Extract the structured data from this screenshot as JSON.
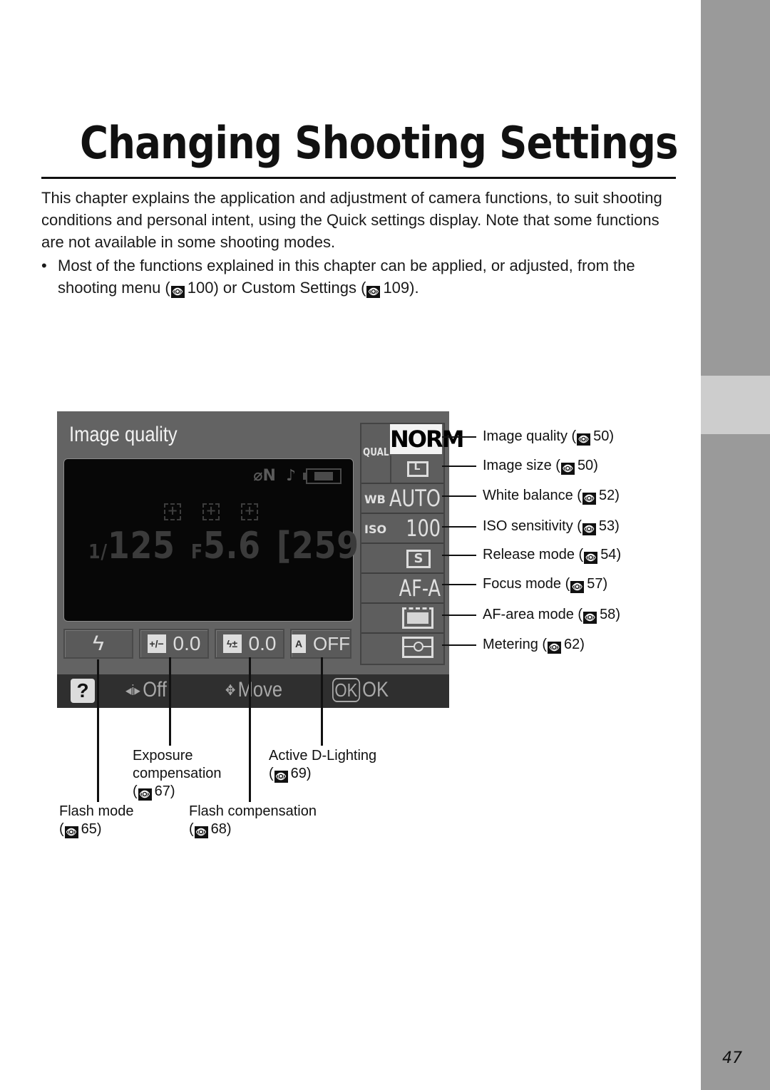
{
  "page": {
    "title": "Changing Shooting Settings",
    "intro": "This chapter explains the application and adjustment of camera functions, to suit shooting conditions and personal intent, using the Quick settings display. Note that some functions are not available in some shooting modes.",
    "bullet": {
      "marker": "•",
      "text_1": "Most of the functions explained in this chapter can be applied, or adjusted, from the shooting menu (",
      "ref_1": "100",
      "text_2": ") or Custom Settings (",
      "ref_2": "109",
      "text_3": ")."
    },
    "page_number": "47",
    "ref_icon_glyph": "👁"
  },
  "screen": {
    "title": "Image quality",
    "viewfinder": {
      "status_icons": [
        "focus-lock-icon",
        "beep-icon",
        "battery-icon"
      ],
      "status_text": "N",
      "af_point_glyph": "+",
      "shutter_prefix": "1/",
      "shutter": "125",
      "aperture_prefix": "F",
      "aperture": "5.6",
      "frames_remaining": "[259]"
    },
    "bottom_row": {
      "flash_glyph": "ϟ",
      "exposure_comp_icon": "+/−",
      "exposure_comp": "0.0",
      "flash_comp_icon": "ϟ±",
      "flash_comp": "0.0",
      "adl_icon": "A",
      "adl": "OFF"
    },
    "right_column": {
      "qual_label": "QUAL",
      "quality": "NORM",
      "wb_label": "WB",
      "white_balance": "AUTO",
      "iso_label": "ISO",
      "iso": "100",
      "release_mode": "S",
      "focus_mode": "AF-A"
    },
    "help_bar": {
      "help": "?",
      "info_icon": "◂i▸",
      "info_label": "Off",
      "move_icon": "✥",
      "move_label": "Move",
      "ok_icon": "OK",
      "ok_label": "OK"
    }
  },
  "callouts": {
    "right": [
      {
        "label": "Image quality (",
        "ref": "50",
        "end": ")"
      },
      {
        "label": "Image size (",
        "ref": "50",
        "end": ")"
      },
      {
        "label": "White balance (",
        "ref": "52",
        "end": ")"
      },
      {
        "label": "ISO sensitivity (",
        "ref": "53",
        "end": ")"
      },
      {
        "label": "Release mode (",
        "ref": "54",
        "end": ")"
      },
      {
        "label": "Focus mode (",
        "ref": "57",
        "end": ")"
      },
      {
        "label": "AF-area mode (",
        "ref": "58",
        "end": ")"
      },
      {
        "label": "Metering (",
        "ref": "62",
        "end": ")"
      }
    ],
    "exposure_comp": {
      "line1": "Exposure",
      "line2": "compensation",
      "ref": "67"
    },
    "active_d_lighting": {
      "line1": "Active D-Lighting",
      "ref": "69"
    },
    "flash_mode": {
      "line1": "Flash mode",
      "ref": "65"
    },
    "flash_comp": {
      "line1": "Flash compensation",
      "ref": "68"
    }
  }
}
